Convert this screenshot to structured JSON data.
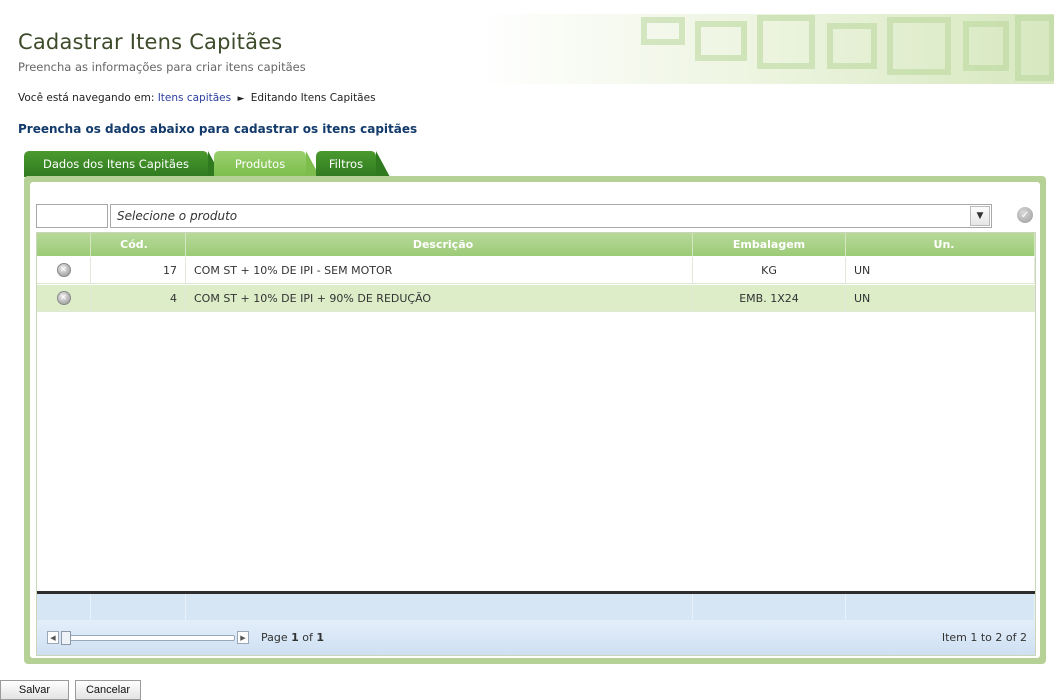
{
  "header": {
    "title": "Cadastrar Itens Capitães",
    "subtitle": "Preencha as informações para criar itens capitães"
  },
  "breadcrumb": {
    "prefix": "Você está navegando em:",
    "link": "Itens capitães",
    "current": "Editando Itens Capitães"
  },
  "section_title": "Preencha os dados abaixo para cadastrar os itens capitães",
  "tabs": [
    {
      "label": "Dados dos Itens Capitães",
      "active": false
    },
    {
      "label": "Produtos",
      "active": true
    },
    {
      "label": "Filtros",
      "active": false
    }
  ],
  "product_picker": {
    "code_value": "",
    "placeholder": "Selecione o produto",
    "dropdown_icon": "chevron-down-icon",
    "confirm_icon": "check-circle-icon"
  },
  "grid": {
    "columns": [
      "",
      "Cód.",
      "Descrição",
      "Embalagem",
      "Un."
    ],
    "rows": [
      {
        "code": "17",
        "description": "COM ST + 10% DE IPI - SEM MOTOR",
        "packaging": "KG",
        "unit": "UN"
      },
      {
        "code": "4",
        "description": "COM ST + 10% DE IPI + 90% DE REDUÇÃO",
        "packaging": "EMB. 1X24",
        "unit": "UN"
      }
    ],
    "row_icon": "remove-icon"
  },
  "pager": {
    "page_prefix": "Page",
    "page_current": "1",
    "page_of": "of",
    "page_total": "1",
    "info": "Item 1 to 2 of 2"
  },
  "actions": {
    "save_label": "Salvar",
    "cancel_label": "Cancelar"
  },
  "colors": {
    "tab_green": "#3b8a26",
    "tab_active": "#8cc65e",
    "panel_border": "#b5d196",
    "title_blue": "#123a6b",
    "grid_header": "#a8d186",
    "alt_row": "#dcedc8",
    "pager_blue": "#d6e6f5"
  }
}
